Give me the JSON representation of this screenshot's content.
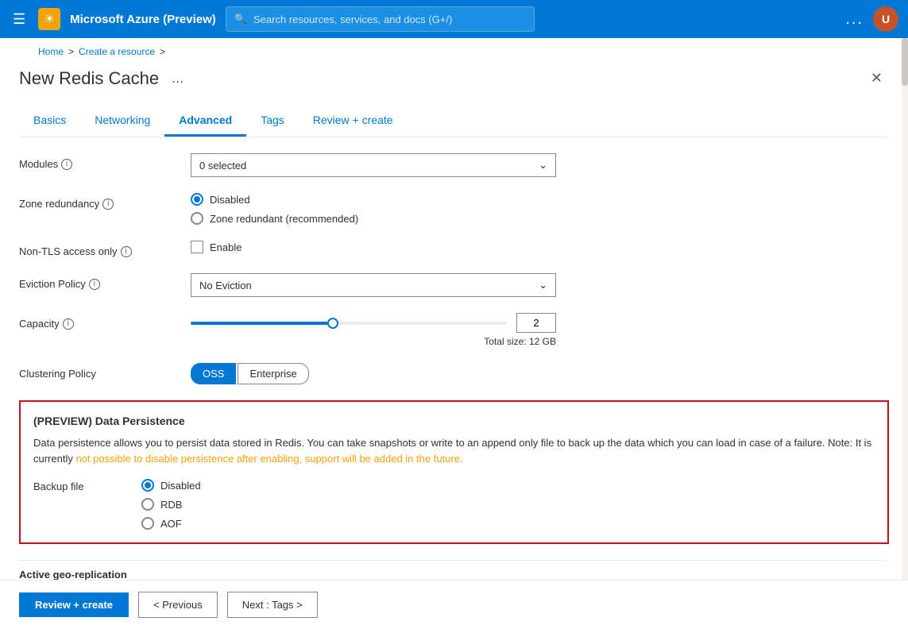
{
  "topbar": {
    "title": "Microsoft Azure (Preview)",
    "icon": "☀",
    "search_placeholder": "Search resources, services, and docs (G+/)",
    "dots": "...",
    "avatar_initials": "U"
  },
  "breadcrumb": {
    "home": "Home",
    "separator1": ">",
    "create_resource": "Create a resource",
    "separator2": ">"
  },
  "panel": {
    "title": "New Redis Cache",
    "ellipsis": "..."
  },
  "tabs": [
    {
      "id": "basics",
      "label": "Basics",
      "active": false
    },
    {
      "id": "networking",
      "label": "Networking",
      "active": false
    },
    {
      "id": "advanced",
      "label": "Advanced",
      "active": true
    },
    {
      "id": "tags",
      "label": "Tags",
      "active": false
    },
    {
      "id": "review",
      "label": "Review + create",
      "active": false
    }
  ],
  "form": {
    "modules": {
      "label": "Modules",
      "value": "0 selected"
    },
    "zone_redundancy": {
      "label": "Zone redundancy",
      "options": [
        {
          "id": "disabled",
          "label": "Disabled",
          "checked": true
        },
        {
          "id": "redundant",
          "label": "Zone redundant (recommended)",
          "checked": false
        }
      ]
    },
    "non_tls": {
      "label": "Non-TLS access only",
      "checkbox_label": "Enable",
      "checked": false
    },
    "eviction_policy": {
      "label": "Eviction Policy",
      "value": "No Eviction"
    },
    "capacity": {
      "label": "Capacity",
      "value": "2",
      "total_size": "Total size: 12 GB"
    },
    "clustering_policy": {
      "label": "Clustering Policy",
      "oss_label": "OSS",
      "enterprise_label": "Enterprise"
    }
  },
  "persistence": {
    "title": "(PREVIEW) Data Persistence",
    "description_part1": "Data persistence allows you to persist data stored in Redis. You can take snapshots or write to an append only file to back up the data which you can load in case of a failure. Note: It is currently ",
    "highlight": "not possible to disable persistence after enabling, support will be added in the future.",
    "backup_file_label": "Backup file",
    "options": [
      {
        "id": "disabled",
        "label": "Disabled",
        "checked": true
      },
      {
        "id": "rdb",
        "label": "RDB",
        "checked": false
      },
      {
        "id": "aof",
        "label": "AOF",
        "checked": false
      }
    ]
  },
  "geo_replication": {
    "label": "Active geo-replication"
  },
  "actions": {
    "review_create": "Review + create",
    "previous": "< Previous",
    "next": "Next : Tags >"
  }
}
